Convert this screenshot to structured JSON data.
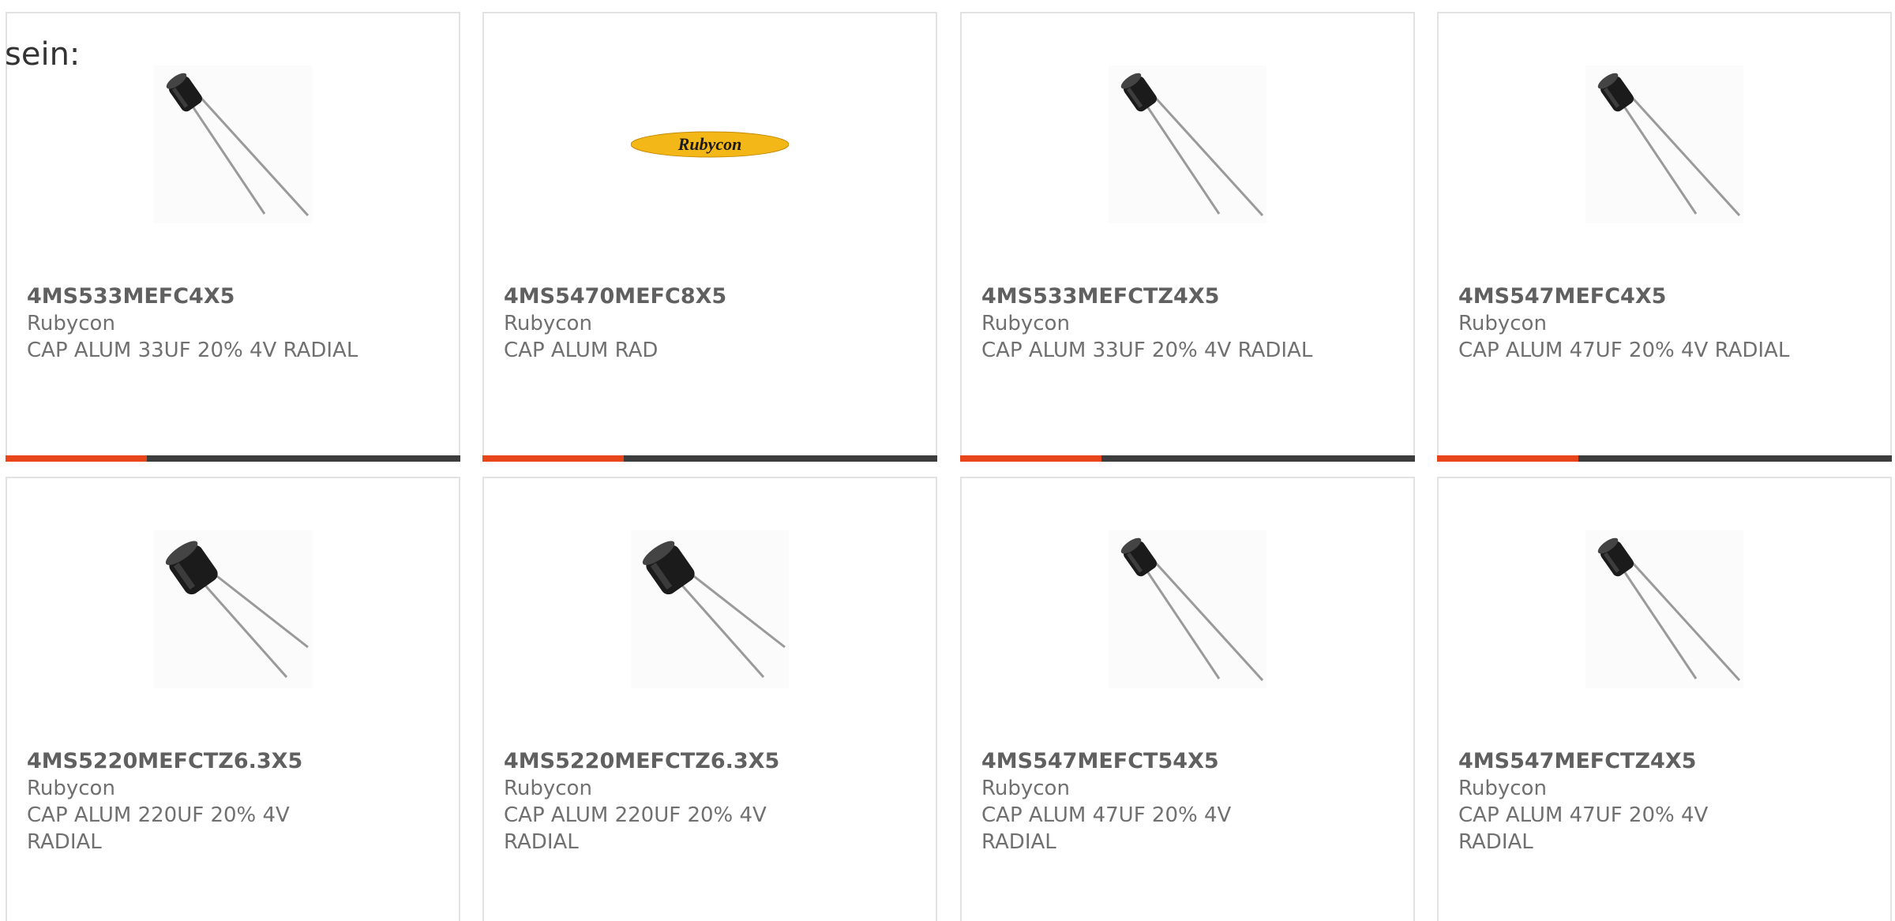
{
  "lead_text": "sein:",
  "colors": {
    "accent": "#e8451a",
    "track": "#3d3d3d",
    "logo_yellow": "#f3b817"
  },
  "products": [
    {
      "part_number": "4MS533MEFC4X5",
      "manufacturer": "Rubycon",
      "description": "CAP ALUM 33UF 20% 4V RADIAL",
      "image": "capacitor-small-icon",
      "progress": 0.31
    },
    {
      "part_number": "4MS5470MEFC8X5",
      "manufacturer": "Rubycon",
      "description": "CAP ALUM RAD",
      "image": "rubycon-logo",
      "logo_text": "Rubycon",
      "progress": 0.31
    },
    {
      "part_number": "4MS533MEFCTZ4X5",
      "manufacturer": "Rubycon",
      "description": "CAP ALUM 33UF 20% 4V RADIAL",
      "image": "capacitor-small-icon",
      "progress": 0.31
    },
    {
      "part_number": "4MS547MEFC4X5",
      "manufacturer": "Rubycon",
      "description": "CAP ALUM 47UF 20% 4V RADIAL",
      "image": "capacitor-small-icon",
      "progress": 0.31
    },
    {
      "part_number": "4MS5220MEFCTZ6.3X5",
      "manufacturer": "Rubycon",
      "description": "CAP ALUM 220UF 20% 4V RADIAL",
      "image": "capacitor-large-icon"
    },
    {
      "part_number": "4MS5220MEFCTZ6.3X5",
      "manufacturer": "Rubycon",
      "description": "CAP ALUM 220UF 20% 4V RADIAL",
      "image": "capacitor-large-icon"
    },
    {
      "part_number": "4MS547MEFCT54X5",
      "manufacturer": "Rubycon",
      "description": "CAP ALUM 47UF 20% 4V RADIAL",
      "image": "capacitor-small-icon"
    },
    {
      "part_number": "4MS547MEFCTZ4X5",
      "manufacturer": "Rubycon",
      "description": "CAP ALUM 47UF 20% 4V RADIAL",
      "image": "capacitor-small-icon"
    }
  ]
}
